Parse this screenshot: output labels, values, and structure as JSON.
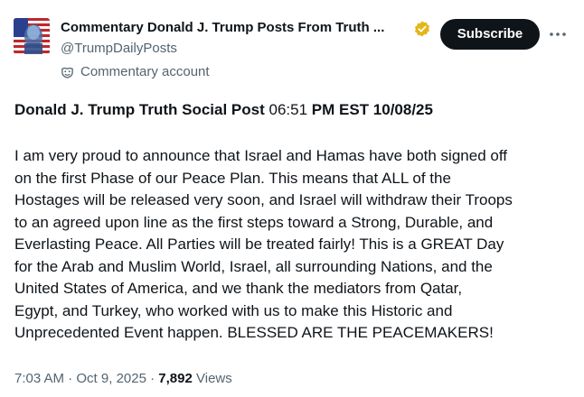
{
  "account": {
    "display_name": "Commentary Donald J. Trump Posts From Truth ...",
    "handle": "@TrumpDailyPosts",
    "label": "Commentary account",
    "avatar_icon": "flag-portrait-avatar",
    "verified_icon": "gold-verified-badge-icon",
    "verified_color": "#e2b719"
  },
  "actions": {
    "subscribe_label": "Subscribe",
    "more_icon": "more-dots-icon"
  },
  "post": {
    "title_bold": "Donald J. Trump Truth Social Post",
    "title_time": "06:51",
    "title_rest": "PM EST 10/08/25",
    "body_lines": [
      "I am very proud to announce that Israel and Hamas have both signed off",
      "on the first Phase of our Peace Plan. This means that ALL of the",
      "Hostages will be released very soon, and Israel will withdraw their Troops",
      "to an agreed upon line as the first steps toward a Strong, Durable, and",
      "Everlasting Peace. All Parties will be treated fairly! This is a GREAT Day",
      "for the Arab and Muslim World, Israel, all surrounding Nations, and the",
      "United States of America, and we thank the mediators from Qatar,",
      "Egypt, and Turkey, who worked with us to make this Historic and",
      "Unprecedented Event happen. BLESSED ARE THE PEACEMAKERS!"
    ]
  },
  "meta": {
    "time": "7:03 AM",
    "date": "Oct 9, 2025",
    "views_count": "7,892",
    "views_label": "Views"
  },
  "colors": {
    "text_primary": "#0f1419",
    "text_secondary": "#536471",
    "button_bg": "#0f1419"
  }
}
